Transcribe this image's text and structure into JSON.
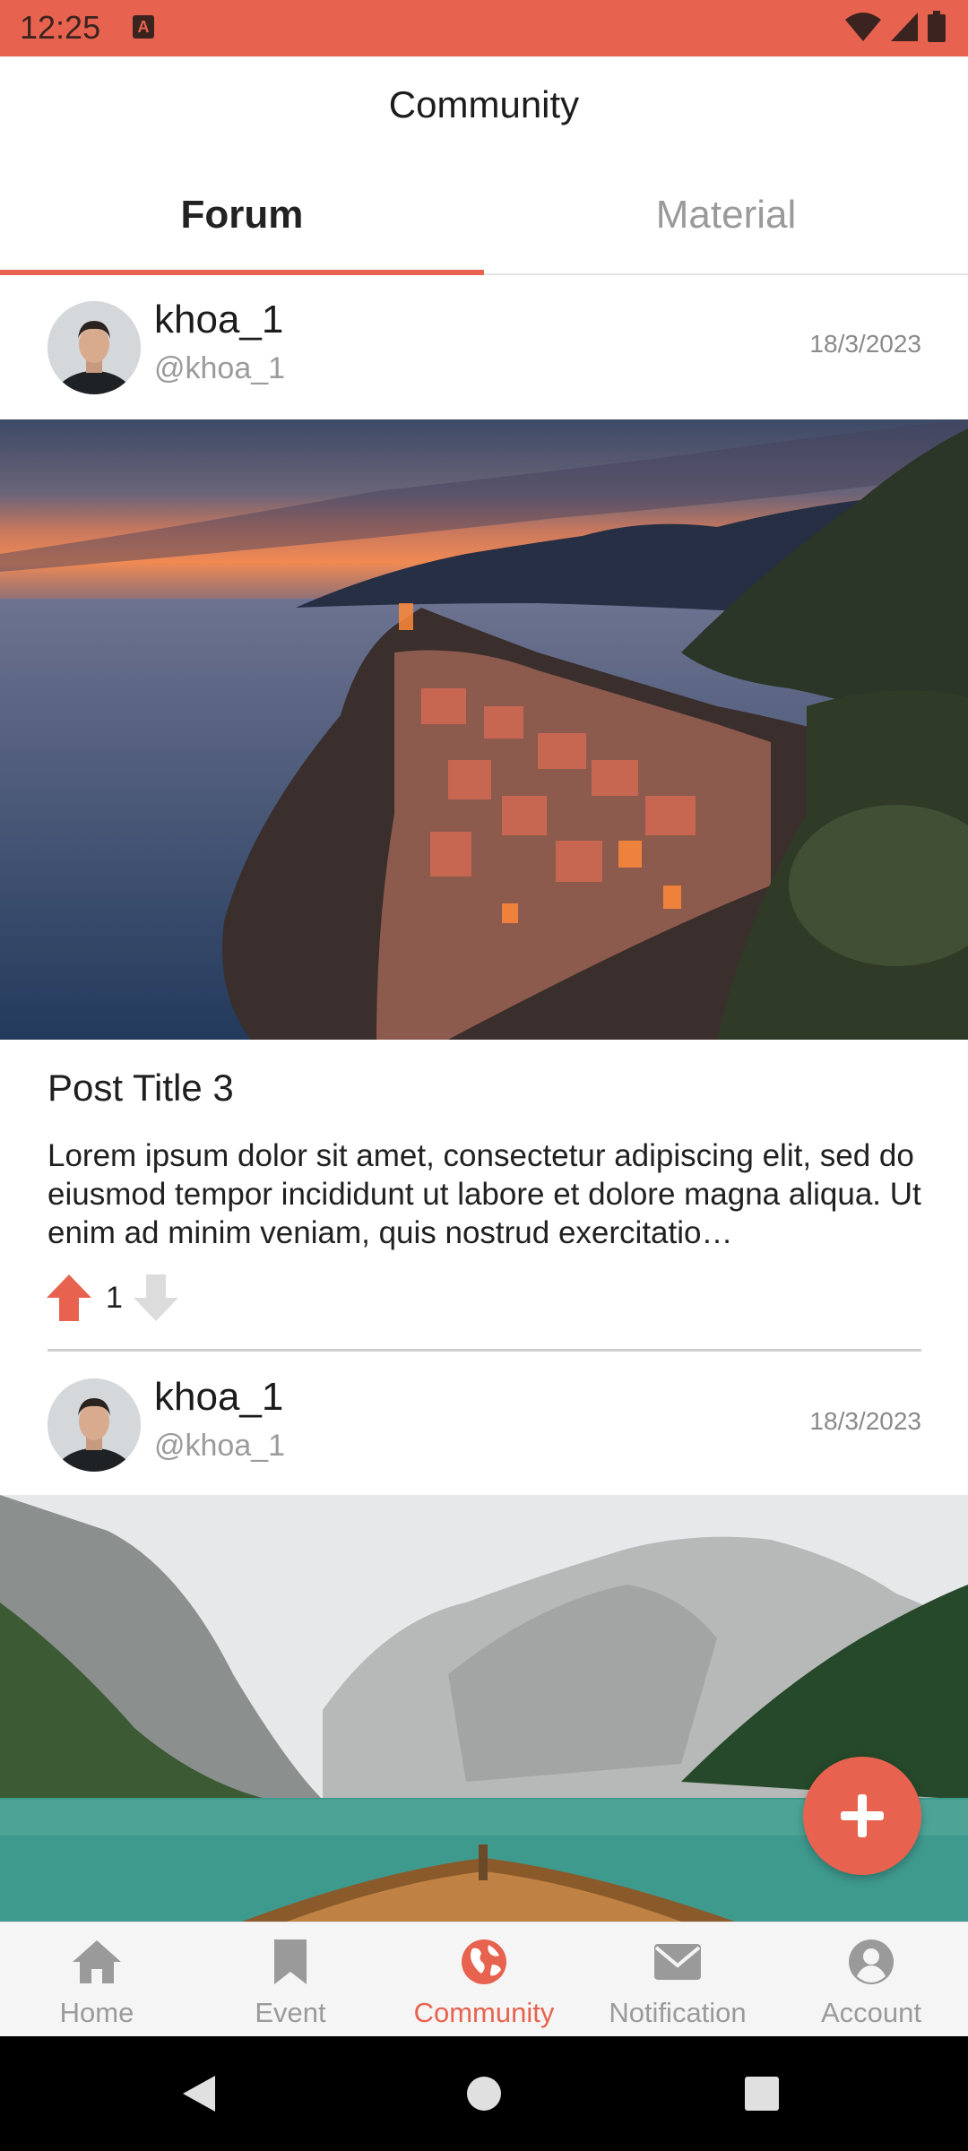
{
  "status_bar": {
    "time": "12:25",
    "notification_icon": "a-icon",
    "icons": [
      "wifi-icon",
      "signal-icon",
      "battery-icon"
    ]
  },
  "app_bar": {
    "title": "Community"
  },
  "tabs": [
    {
      "label": "Forum",
      "active": true
    },
    {
      "label": "Material",
      "active": false
    }
  ],
  "posts": [
    {
      "username": "khoa_1",
      "handle": "@khoa_1",
      "date": "18/3/2023",
      "image": "coastal-village-sunset",
      "title": "Post Title 3",
      "body": "Lorem ipsum dolor sit amet, consectetur adipiscing elit, sed do eiusmod tempor incididunt ut labore et dolore magna aliqua. Ut enim ad minim veniam, quis nostrud exercitatio…",
      "votes": "1"
    },
    {
      "username": "khoa_1",
      "handle": "@khoa_1",
      "date": "18/3/2023",
      "image": "mountain-lake-boat"
    }
  ],
  "fab": {
    "icon": "plus-icon"
  },
  "bottom_nav": [
    {
      "label": "Home",
      "icon": "home-icon",
      "active": false
    },
    {
      "label": "Event",
      "icon": "bookmark-icon",
      "active": false
    },
    {
      "label": "Community",
      "icon": "globe-icon",
      "active": true
    },
    {
      "label": "Notification",
      "icon": "mail-icon",
      "active": false
    },
    {
      "label": "Account",
      "icon": "account-icon",
      "active": false
    }
  ],
  "colors": {
    "accent": "#e8634f",
    "inactive": "#9a9a9a",
    "status_bar": "#e8634f"
  }
}
